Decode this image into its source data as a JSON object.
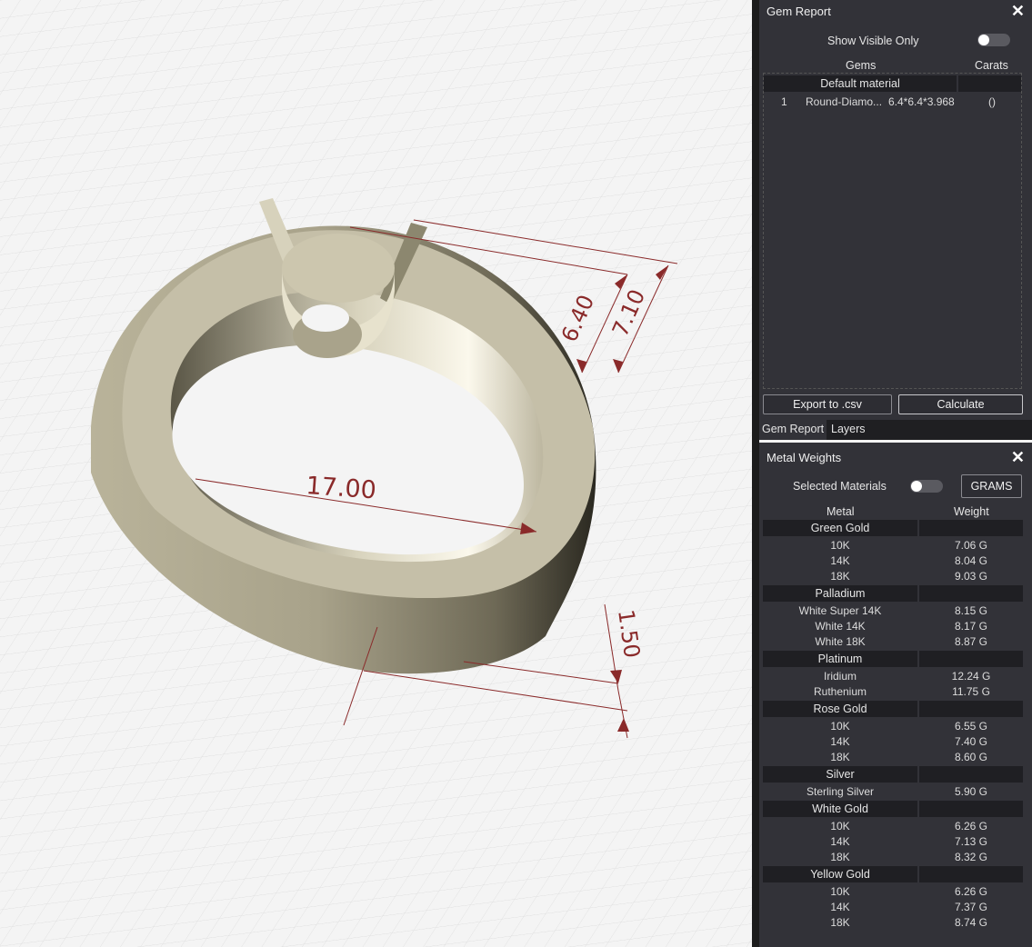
{
  "viewport": {
    "dimensions": [
      "17.00",
      "6.40",
      "7.10",
      "1.50"
    ],
    "colors": {
      "metal": "#c5bfa8",
      "metal_dark": "#8d876f",
      "dim_line": "#8a2a2a",
      "grid": "#d9d9d9"
    }
  },
  "gem_report": {
    "title": "Gem Report",
    "show_visible_only": "Show Visible Only",
    "col_gems": "Gems",
    "col_carats": "Carats",
    "group": "Default material",
    "rows": [
      {
        "index": "1",
        "name": "Round-Diamo...",
        "size": "6.4*6.4*3.968",
        "carats": "()"
      }
    ],
    "export_button": "Export to .csv",
    "calculate_button": "Calculate"
  },
  "tabs": {
    "gem_report": "Gem Report",
    "layers": "Layers"
  },
  "metal_weights": {
    "title": "Metal Weights",
    "selected_materials": "Selected Materials",
    "units_button": "GRAMS",
    "col_metal": "Metal",
    "col_weight": "Weight",
    "groups": [
      {
        "name": "Green Gold",
        "items": [
          {
            "metal": "10K",
            "weight": "7.06 G"
          },
          {
            "metal": "14K",
            "weight": "8.04 G"
          },
          {
            "metal": "18K",
            "weight": "9.03 G"
          }
        ]
      },
      {
        "name": "Palladium",
        "items": [
          {
            "metal": "White Super 14K",
            "weight": "8.15 G"
          },
          {
            "metal": "White 14K",
            "weight": "8.17 G"
          },
          {
            "metal": "White 18K",
            "weight": "8.87 G"
          }
        ]
      },
      {
        "name": "Platinum",
        "items": [
          {
            "metal": "Iridium",
            "weight": "12.24 G"
          },
          {
            "metal": "Ruthenium",
            "weight": "11.75 G"
          }
        ]
      },
      {
        "name": "Rose Gold",
        "items": [
          {
            "metal": "10K",
            "weight": "6.55 G"
          },
          {
            "metal": "14K",
            "weight": "7.40 G"
          },
          {
            "metal": "18K",
            "weight": "8.60 G"
          }
        ]
      },
      {
        "name": "Silver",
        "items": [
          {
            "metal": "Sterling Silver",
            "weight": "5.90 G"
          }
        ]
      },
      {
        "name": "White Gold",
        "items": [
          {
            "metal": "10K",
            "weight": "6.26 G"
          },
          {
            "metal": "14K",
            "weight": "7.13 G"
          },
          {
            "metal": "18K",
            "weight": "8.32 G"
          }
        ]
      },
      {
        "name": "Yellow Gold",
        "items": [
          {
            "metal": "10K",
            "weight": "6.26 G"
          },
          {
            "metal": "14K",
            "weight": "7.37 G"
          },
          {
            "metal": "18K",
            "weight": "8.74 G"
          }
        ]
      }
    ]
  }
}
